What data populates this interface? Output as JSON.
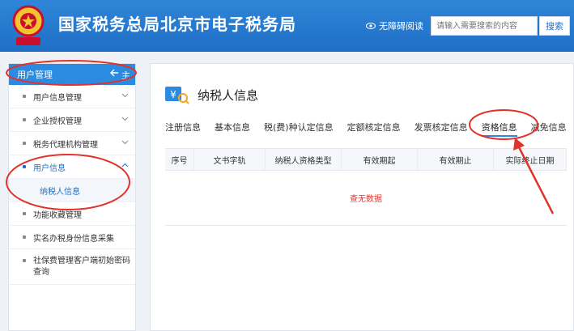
{
  "header": {
    "site_title": "国家税务总局北京市电子税务局",
    "accessibility_label": "无障碍阅读",
    "search_placeholder": "请输入需要搜索的内容",
    "search_button": "搜索"
  },
  "sidebar": {
    "title": "用户管理",
    "collapse_label": "主",
    "items": [
      {
        "label": "用户信息管理"
      },
      {
        "label": "企业授权管理"
      },
      {
        "label": "税务代理机构管理"
      },
      {
        "label": "用户信息"
      },
      {
        "label": "纳税人信息"
      },
      {
        "label": "功能收藏管理"
      },
      {
        "label": "实名办税身份信息采集"
      },
      {
        "label": "社保费管理客户端初始密码查询"
      }
    ]
  },
  "main": {
    "page_title": "纳税人信息",
    "tabs": [
      {
        "label": "注册信息"
      },
      {
        "label": "基本信息"
      },
      {
        "label": "税(费)种认定信息"
      },
      {
        "label": "定额核定信息"
      },
      {
        "label": "发票核定信息"
      },
      {
        "label": "资格信息"
      },
      {
        "label": "减免信息"
      }
    ],
    "active_tab": "资格信息",
    "table": {
      "columns": [
        "序号",
        "文书字轨",
        "纳税人资格类型",
        "有效期起",
        "有效期止",
        "实际终止日期"
      ],
      "empty_text": "查无数据"
    }
  },
  "colors": {
    "header_blue": "#1f6fc6",
    "accent_blue": "#2a8be0",
    "annotation_red": "#e0332b"
  }
}
